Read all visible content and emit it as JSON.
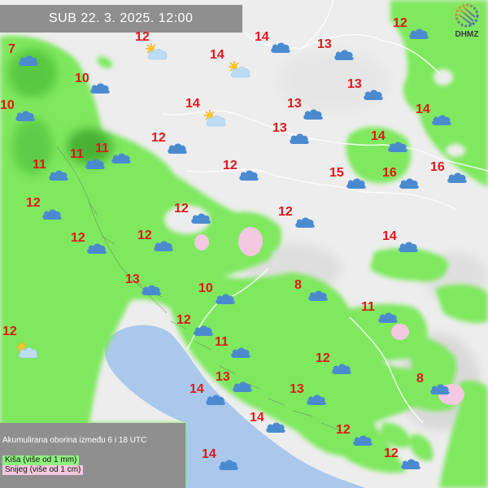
{
  "header": {
    "datetime": "SUB  22. 3. 2025. 12:00"
  },
  "logo": {
    "text": "DHMZ",
    "icon": "dhmz-logo-icon"
  },
  "legend": {
    "title": "Akumulirana oborina između 6 i 18 UTC",
    "rain": "Kiša (više od 1 mm)",
    "snow": "Snijeg (više od 1 cm)",
    "rain_color": "#8ff080",
    "snow_color": "#f3c8e0"
  },
  "colors": {
    "rain_light": "#7fe85f",
    "rain_dark": "#3aa52a",
    "sea": "#aac8ec",
    "land": "#ededed",
    "temperature": "#e01818",
    "cloud": "#4a8bd0"
  },
  "stations": [
    {
      "temp": "7",
      "icon": "cloud-icon"
    },
    {
      "temp": "10",
      "icon": "cloud-icon"
    },
    {
      "temp": "10",
      "icon": "cloud-icon"
    },
    {
      "temp": "12",
      "icon": "partly-cloudy-icon"
    },
    {
      "temp": "14",
      "icon": "cloud-icon"
    },
    {
      "temp": "14",
      "icon": "partly-cloudy-icon"
    },
    {
      "temp": "13",
      "icon": "cloud-icon"
    },
    {
      "temp": "12",
      "icon": "cloud-icon"
    },
    {
      "temp": "13",
      "icon": "cloud-icon"
    },
    {
      "temp": "14",
      "icon": "partly-cloudy-icon"
    },
    {
      "temp": "13",
      "icon": "cloud-icon"
    },
    {
      "temp": "14",
      "icon": "cloud-icon"
    },
    {
      "temp": "13",
      "icon": "cloud-icon"
    },
    {
      "temp": "12",
      "icon": "cloud-icon"
    },
    {
      "temp": "14",
      "icon": "cloud-icon"
    },
    {
      "temp": "11",
      "icon": "cloud-icon"
    },
    {
      "temp": "11",
      "icon": "cloud-icon"
    },
    {
      "temp": "11",
      "icon": "cloud-icon"
    },
    {
      "temp": "12",
      "icon": "cloud-icon"
    },
    {
      "temp": "15",
      "icon": "cloud-icon"
    },
    {
      "temp": "16",
      "icon": "cloud-icon"
    },
    {
      "temp": "16",
      "icon": "cloud-icon"
    },
    {
      "temp": "12",
      "icon": "cloud-icon"
    },
    {
      "temp": "12",
      "icon": "cloud-icon"
    },
    {
      "temp": "12",
      "icon": "cloud-icon"
    },
    {
      "temp": "12",
      "icon": "cloud-icon"
    },
    {
      "temp": "12",
      "icon": "cloud-icon"
    },
    {
      "temp": "14",
      "icon": "cloud-icon"
    },
    {
      "temp": "13",
      "icon": "cloud-icon"
    },
    {
      "temp": "10",
      "icon": "cloud-icon"
    },
    {
      "temp": "8",
      "icon": "cloud-icon"
    },
    {
      "temp": "12",
      "icon": "partly-cloudy-icon"
    },
    {
      "temp": "12",
      "icon": "cloud-icon"
    },
    {
      "temp": "11",
      "icon": "cloud-icon"
    },
    {
      "temp": "11",
      "icon": "cloud-icon"
    },
    {
      "temp": "12",
      "icon": "cloud-icon"
    },
    {
      "temp": "8",
      "icon": "cloud-icon"
    },
    {
      "temp": "14",
      "icon": "cloud-icon"
    },
    {
      "temp": "13",
      "icon": "cloud-icon"
    },
    {
      "temp": "13",
      "icon": "cloud-icon"
    },
    {
      "temp": "14",
      "icon": "cloud-icon"
    },
    {
      "temp": "12",
      "icon": "cloud-icon"
    },
    {
      "temp": "14",
      "icon": "cloud-icon"
    },
    {
      "temp": "12",
      "icon": "cloud-icon"
    }
  ]
}
